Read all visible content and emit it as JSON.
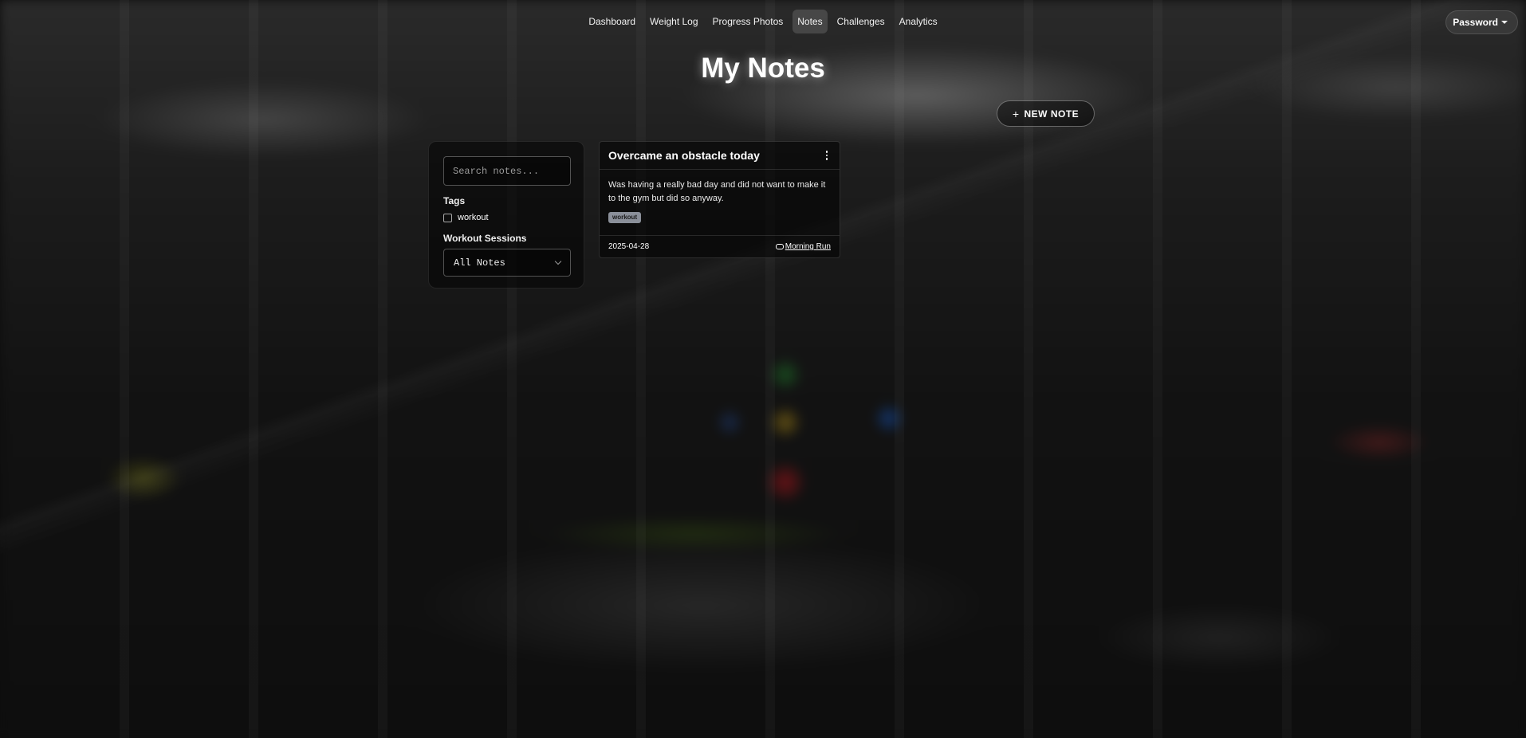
{
  "nav": {
    "items": [
      {
        "label": "Dashboard"
      },
      {
        "label": "Weight Log"
      },
      {
        "label": "Progress Photos"
      },
      {
        "label": "Notes",
        "active": true
      },
      {
        "label": "Challenges"
      },
      {
        "label": "Analytics"
      }
    ],
    "user_menu_label": "Password"
  },
  "page": {
    "title": "My Notes",
    "new_note_label": "NEW NOTE"
  },
  "sidebar": {
    "search_placeholder": "Search notes...",
    "tags_heading": "Tags",
    "tags": [
      {
        "label": "workout",
        "checked": false
      }
    ],
    "sessions_heading": "Workout Sessions",
    "sessions_selected": "All Notes"
  },
  "notes": [
    {
      "title": "Overcame an obstacle today",
      "body": "Was having a really bad day and did not want to make it to the gym but did so anyway.",
      "tag": "workout",
      "date": "2025-04-28",
      "linked_session": "Morning Run"
    }
  ],
  "icons": {
    "plus": "plus-icon",
    "caret": "caret-down-icon",
    "more": "more-vertical-icon",
    "link": "link-icon",
    "chevron": "chevron-down-icon"
  }
}
